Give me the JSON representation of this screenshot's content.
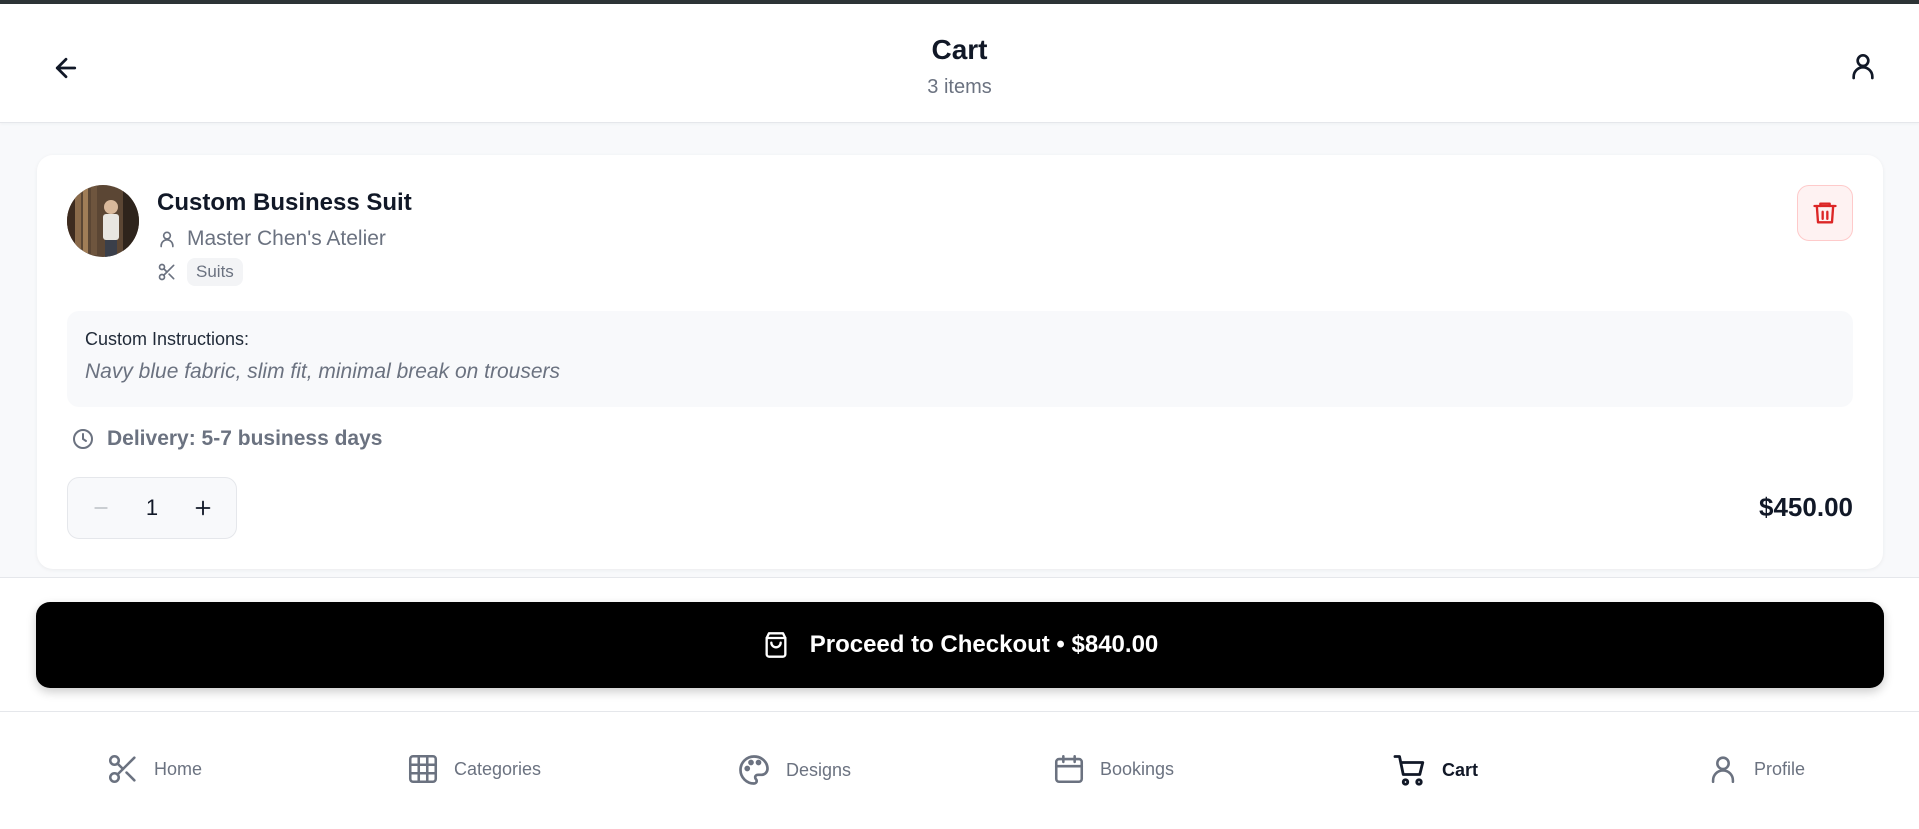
{
  "header": {
    "title": "Cart",
    "subtitle": "3 items"
  },
  "cart_item": {
    "name": "Custom Business Suit",
    "shop": "Master Chen's Atelier",
    "category": "Suits",
    "instructions_label": "Custom Instructions:",
    "instructions_text": "Navy blue fabric, slim fit, minimal break on trousers",
    "delivery": "Delivery: 5-7 business days",
    "quantity": "1",
    "price": "$450.00"
  },
  "checkout": {
    "label": "Proceed to Checkout • $840.00"
  },
  "nav": {
    "items": [
      {
        "label": "Home",
        "icon": "scissors-icon"
      },
      {
        "label": "Categories",
        "icon": "grid-icon"
      },
      {
        "label": "Designs",
        "icon": "palette-icon"
      },
      {
        "label": "Bookings",
        "icon": "calendar-icon"
      },
      {
        "label": "Cart",
        "icon": "cart-icon",
        "active": true
      },
      {
        "label": "Profile",
        "icon": "user-icon"
      }
    ]
  },
  "colors": {
    "accent": "#000000",
    "danger": "#dc2626",
    "muted": "#6b7280"
  }
}
